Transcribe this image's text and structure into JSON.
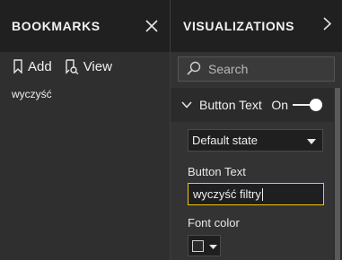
{
  "bookmarks": {
    "title": "BOOKMARKS",
    "add_label": "Add",
    "view_label": "View",
    "items": [
      "wyczyść"
    ]
  },
  "visualizations": {
    "title": "VISUALIZATIONS",
    "search_placeholder": "Search",
    "section": {
      "label": "Button Text",
      "toggle_label": "On",
      "toggle_on": true
    },
    "state_dropdown": {
      "selected": "Default state"
    },
    "button_text": {
      "label": "Button Text",
      "value": "wyczyść filtry"
    },
    "font_color": {
      "label": "Font color",
      "swatch": "#2a2a2a"
    }
  },
  "colors": {
    "header_bg": "#202020",
    "pane_bg": "#2f2f2f",
    "accent_focus": "#f2c811"
  }
}
